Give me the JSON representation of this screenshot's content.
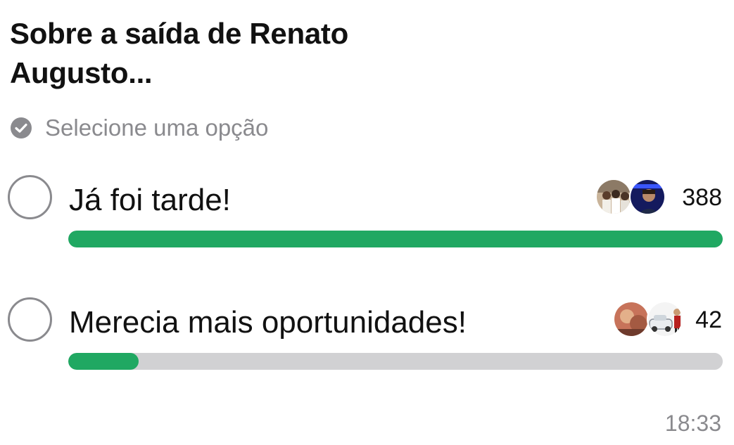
{
  "poll": {
    "title": "Sobre a saída de Renato Augusto...",
    "subtitle": "Selecione uma opção",
    "subtitle_icon": "check-circle-icon",
    "options": [
      {
        "label": "Já foi tarde!",
        "votes": "388",
        "fraction": 1.0,
        "avatars": [
          "group-photo-avatar",
          "person-blue-light-avatar"
        ]
      },
      {
        "label": "Merecia mais oportunidades!",
        "votes": "42",
        "fraction": 0.108,
        "avatars": [
          "warm-photo-avatar",
          "car-photo-avatar"
        ]
      }
    ],
    "timestamp": "18:33"
  },
  "colors": {
    "bar_fill": "#20a862",
    "bar_track": "#d1d1d3",
    "muted_text": "#8a8a8e",
    "text": "#111111"
  }
}
